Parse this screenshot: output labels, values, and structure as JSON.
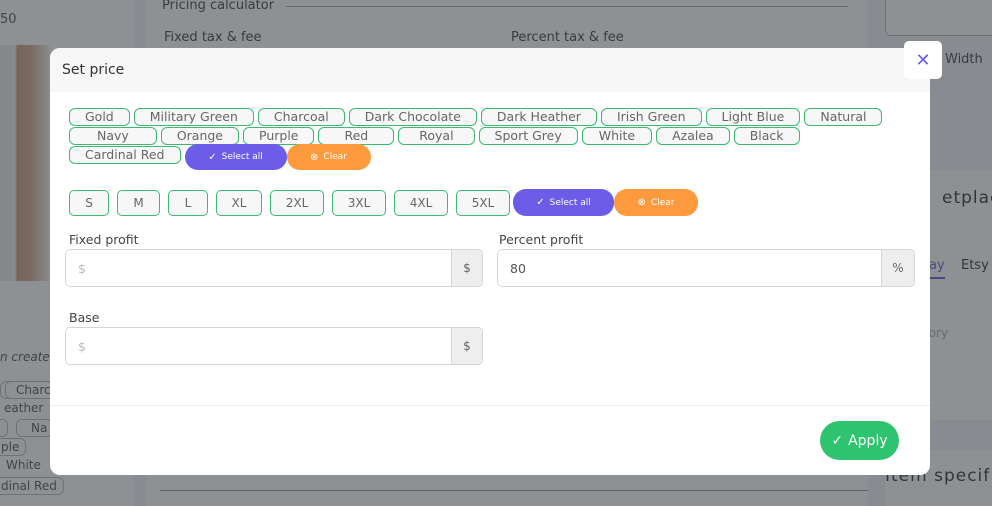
{
  "background": {
    "left_price_fragment": "50",
    "left_note_fragment": "n create",
    "left_chips": [
      "Charc",
      "eather",
      "Na",
      "ple",
      "White",
      "dinal Red"
    ],
    "center_title": "Pricing calculator",
    "center_labels": [
      "Fixed tax & fee",
      "Percent tax & fee"
    ],
    "right_width_label": "Width",
    "right_marketplace_fragment": "etplace",
    "right_tabs": [
      "ay",
      "Etsy"
    ],
    "right_category_label_fragment": "y",
    "right_category_placeholder_fragment": "tegory",
    "right_item_specifics_fragment": "Item specif"
  },
  "modal": {
    "title": "Set price",
    "close_icon": "close-icon",
    "colors": {
      "items": [
        "Gold",
        "Military Green",
        "Charcoal",
        "Dark Chocolate",
        "Dark Heather",
        "Irish Green",
        "Light Blue",
        "Natural",
        "Navy",
        "Orange",
        "Purple",
        "Red",
        "Royal",
        "Sport Grey",
        "White",
        "Azalea",
        "Black",
        "Cardinal Red"
      ],
      "select_all_label": "Select all",
      "clear_label": "Clear"
    },
    "sizes": {
      "items": [
        "S",
        "M",
        "L",
        "XL",
        "2XL",
        "3XL",
        "4XL",
        "5XL"
      ],
      "select_all_label": "Select all",
      "clear_label": "Clear"
    },
    "fixed_profit": {
      "label": "Fixed profit",
      "value": "",
      "placeholder": "$",
      "addon": "$"
    },
    "percent_profit": {
      "label": "Percent profit",
      "value": "80",
      "placeholder": "",
      "addon": "%"
    },
    "base": {
      "label": "Base",
      "value": "",
      "placeholder": "$",
      "addon": "$"
    },
    "apply_label": "Apply"
  },
  "theme": {
    "primary": "#6c5ce7",
    "warning": "#fd9a3e",
    "success": "#2ec46f",
    "chip_border": "#3dba6f"
  }
}
